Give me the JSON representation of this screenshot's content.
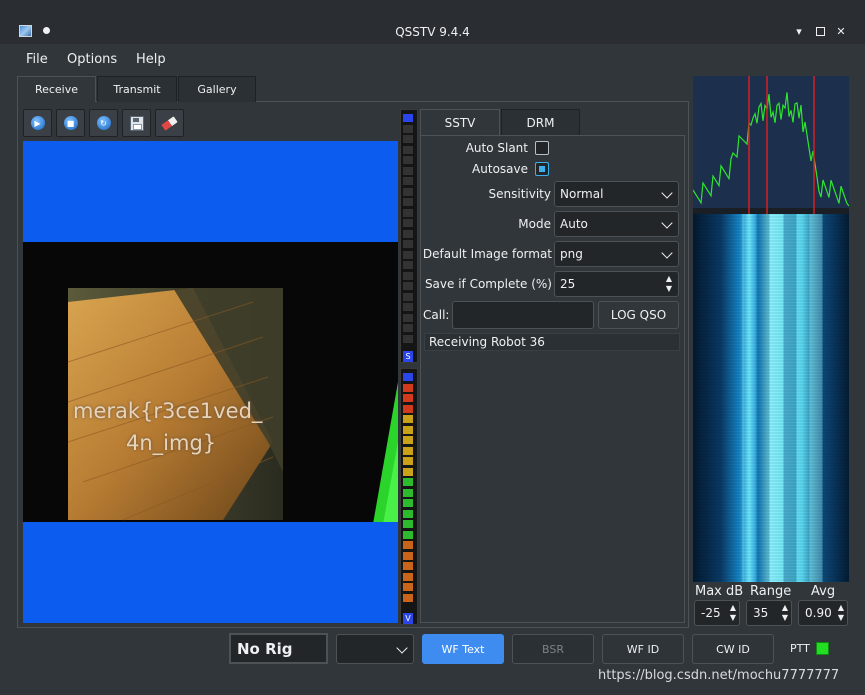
{
  "window": {
    "title": "QSSTV 9.4.4",
    "minimize": "▾",
    "maximize": "□",
    "close": "✕"
  },
  "menu": [
    "File",
    "Options",
    "Help"
  ],
  "tabs": [
    "Receive",
    "Transmit",
    "Gallery"
  ],
  "meter_labels": {
    "signal": "S",
    "volume": "V"
  },
  "image_overlay": {
    "line1": "merak{r3ce1ved_",
    "line2": "4n_img}"
  },
  "sstv_tabs": [
    "SSTV",
    "DRM"
  ],
  "form": {
    "auto_slant_label": "Auto Slant",
    "auto_slant_checked": false,
    "autosave_label": "Autosave",
    "autosave_checked": true,
    "sensitivity_label": "Sensitivity",
    "sensitivity_value": "Normal",
    "mode_label": "Mode",
    "mode_value": "Auto",
    "image_format_label": "Default Image format",
    "image_format_value": "png",
    "save_if_complete_label": "Save if Complete (%)",
    "save_if_complete_value": "25",
    "call_label": "Call:",
    "call_value": "",
    "log_qso_label": "LOG QSO",
    "status_text": "Receiving Robot 36"
  },
  "waterfall": {
    "max_db_label": "Max dB",
    "range_label": "Range",
    "avg_label": "Avg",
    "max_db_value": "-25",
    "range_value": "35",
    "avg_value": "0.90"
  },
  "statusbar": {
    "rig": "No Rig",
    "combo_value": "",
    "wf_text": "WF Text",
    "bsr": "BSR",
    "wf_id": "WF ID",
    "cw_id": "CW ID",
    "ptt": "PTT"
  },
  "watermark": "https://blog.csdn.net/mochu7777777",
  "colors": {
    "accent": "#3daee9",
    "button_active": "#3f8cf0",
    "ptt_led": "#22dd22",
    "image_blue": "#0b5cef"
  }
}
